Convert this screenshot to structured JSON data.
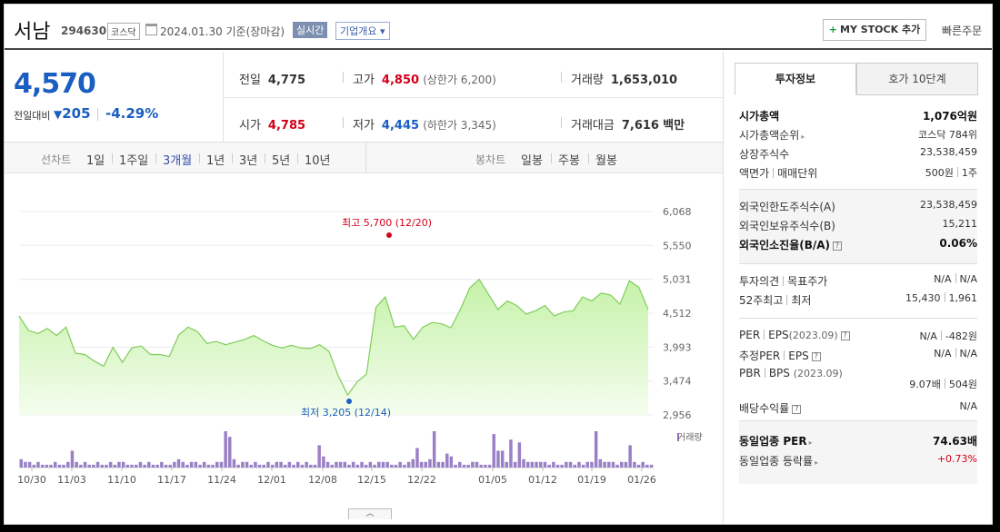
{
  "header": {
    "name": "서남",
    "code": "294630",
    "market": "코스닥",
    "date": "2024.01.30 기준(장마감)",
    "realtime": "실시간",
    "company_info": "기업개요 ▾",
    "mystock": "MY STOCK 추가",
    "quick_order": "빠른주문"
  },
  "quote": {
    "price": "4,570",
    "prev_label": "전일대비",
    "change": "205",
    "change_pct": "-4.29%",
    "items": {
      "prev_close": {
        "label": "전일",
        "value": "4,775"
      },
      "high": {
        "label": "고가",
        "value": "4,850",
        "sub": "(상한가 6,200)"
      },
      "volume": {
        "label": "거래량",
        "value": "1,653,010"
      },
      "open": {
        "label": "시가",
        "value": "4,785"
      },
      "low": {
        "label": "저가",
        "value": "4,445",
        "sub": "(하한가 3,345)"
      },
      "amount": {
        "label": "거래대금",
        "value": "7,616",
        "unit": "백만"
      }
    }
  },
  "period_bar": {
    "line_label": "선차트",
    "line_periods": [
      "1일",
      "1주일",
      "3개월",
      "1년",
      "3년",
      "5년",
      "10년"
    ],
    "active": "3개월",
    "candle_label": "봉차트",
    "candle_periods": [
      "일봉",
      "주봉",
      "월봉"
    ]
  },
  "chart_data": {
    "type": "area",
    "title": "",
    "ytick_labels": [
      "6,068",
      "5,550",
      "5,031",
      "4,512",
      "3,993",
      "3,474",
      "2,956"
    ],
    "ylim": [
      2956,
      6068
    ],
    "x_tick_labels": [
      "10/30",
      "11/03",
      "11/10",
      "11/17",
      "11/24",
      "12/01",
      "12/08",
      "12/15",
      "12/22",
      "01/05",
      "01/12",
      "01/19",
      "01/26"
    ],
    "values": [
      4470,
      4250,
      4200,
      4280,
      4170,
      4300,
      3900,
      3880,
      3780,
      3700,
      3990,
      3760,
      3980,
      4010,
      3880,
      3880,
      3850,
      4180,
      4300,
      4230,
      4050,
      4080,
      4030,
      4070,
      4110,
      4170,
      4090,
      4020,
      3980,
      4020,
      3980,
      3970,
      4030,
      3930,
      3550,
      3260,
      3460,
      3580,
      4600,
      4760,
      4300,
      4320,
      4110,
      4300,
      4370,
      4350,
      4290,
      4570,
      4900,
      5030,
      4800,
      4570,
      4700,
      4630,
      4500,
      4550,
      4630,
      4470,
      4530,
      4550,
      4760,
      4700,
      4820,
      4790,
      4650,
      5010,
      4910,
      4570
    ],
    "high_label": "최고 5,700 (12/20)",
    "low_label": "최저 3,205 (12/14)",
    "volume_label": "거래량",
    "volume": [
      3,
      2,
      2,
      1,
      2,
      1,
      1,
      1,
      2,
      1,
      1,
      2,
      6,
      2,
      1,
      2,
      1,
      1,
      2,
      1,
      1,
      2,
      1,
      2,
      2,
      1,
      1,
      1,
      2,
      1,
      2,
      1,
      1,
      2,
      1,
      1,
      2,
      3,
      2,
      1,
      2,
      2,
      1,
      2,
      1,
      1,
      2,
      2,
      13,
      11,
      3,
      1,
      2,
      2,
      1,
      2,
      1,
      1,
      2,
      1,
      2,
      2,
      1,
      2,
      1,
      2,
      1,
      2,
      1,
      1,
      8,
      4,
      2,
      1,
      2,
      2,
      2,
      1,
      2,
      1,
      2,
      1,
      2,
      1,
      2,
      2,
      2,
      1,
      1,
      2,
      1,
      2,
      3,
      7,
      2,
      2,
      3,
      13,
      2,
      2,
      5,
      4,
      1,
      2,
      1,
      1,
      2,
      2,
      1,
      1,
      1,
      12,
      6,
      6,
      2,
      10,
      2,
      9,
      3,
      2,
      2,
      2,
      2,
      2,
      1,
      2,
      1,
      1,
      2,
      2,
      1,
      2,
      1,
      2,
      2,
      13,
      3,
      2,
      2,
      2,
      1,
      2,
      2,
      8,
      2,
      1,
      2,
      1,
      1
    ]
  },
  "right_panel": {
    "tabs": [
      "투자정보",
      "호가 10단계"
    ],
    "market_cap": {
      "label": "시가총액",
      "value": "1,076억원"
    },
    "market_cap_rank": {
      "label": "시가총액순위",
      "value": "코스닥 784위"
    },
    "listed_shares": {
      "label": "상장주식수",
      "value": "23,538,459"
    },
    "par_unit": {
      "label1": "액면가",
      "label2": "매매단위",
      "value1": "500원",
      "value2": "1주"
    },
    "foreign_limit": {
      "label": "외국인한도주식수(A)",
      "value": "23,538,459"
    },
    "foreign_hold": {
      "label": "외국인보유주식수(B)",
      "value": "15,211"
    },
    "foreign_ratio": {
      "label": "외국인소진율(B/A)",
      "value": "0.06%"
    },
    "opinion": {
      "label1": "투자의견",
      "label2": "목표주가",
      "value1": "N/A",
      "value2": "N/A"
    },
    "week52": {
      "label1": "52주최고",
      "label2": "최저",
      "value1": "15,430",
      "value2": "1,961"
    },
    "per_eps": {
      "label1": "PER",
      "label2": "EPS",
      "period": "(2023.09)",
      "value1": "N/A",
      "value2": "-482원"
    },
    "est_per_eps": {
      "label1": "추정PER",
      "label2": "EPS",
      "value1": "N/A",
      "value2": "N/A"
    },
    "pbr_bps": {
      "label1": "PBR",
      "label2": "BPS",
      "period": "(2023.09)",
      "value1": "9.07배",
      "value2": "504원"
    },
    "dividend": {
      "label": "배당수익률",
      "value": "N/A"
    },
    "industry_per": {
      "label": "동일업종 PER",
      "value": "74.63배"
    },
    "industry_chg": {
      "label": "동일업종 등락률",
      "value": "+0.73%"
    }
  }
}
